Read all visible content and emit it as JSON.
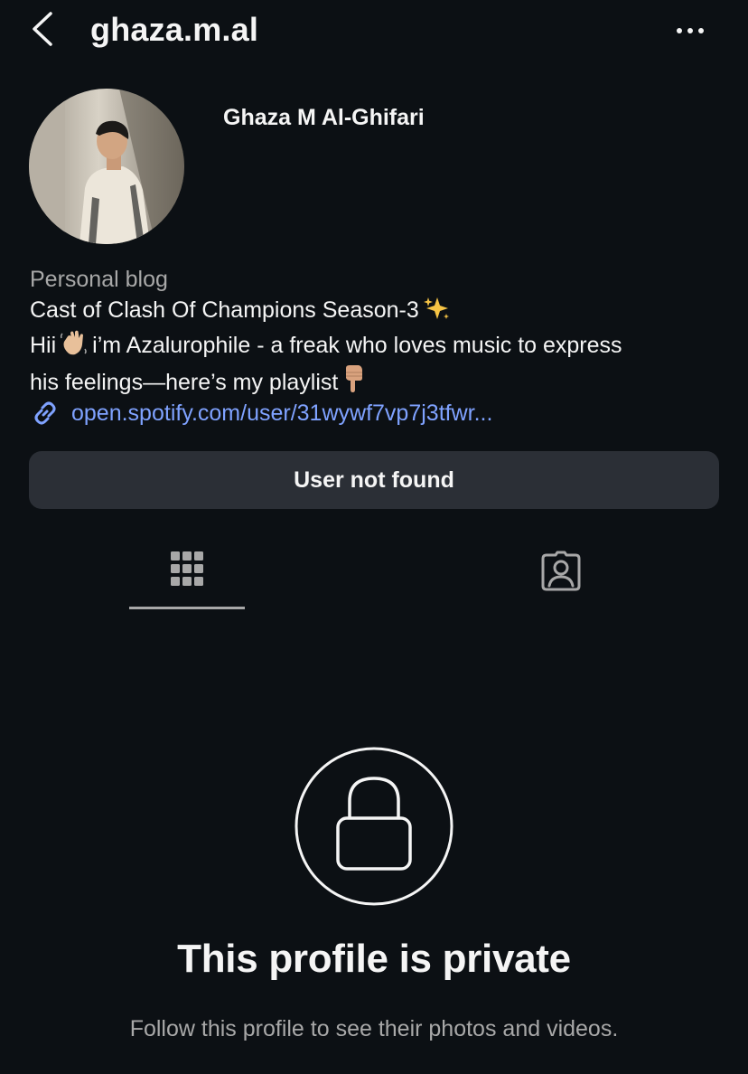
{
  "header": {
    "username": "ghaza.m.al",
    "back_icon": "chevron-left-icon",
    "more_icon": "more-horizontal-icon"
  },
  "profile": {
    "full_name": "Ghaza M Al-Ghifari",
    "avatar": "profile-photo",
    "category": "Personal blog",
    "bio_line_1": "Cast of Clash Of Champions Season-3",
    "bio_line_1_emoji": "sparkles",
    "bio_line_2_pre": "Hii",
    "bio_line_2_emoji": "waving-hand",
    "bio_line_2_post": "i’m Azalurophile - a freak who loves music to express",
    "bio_line_3": "his feelings—here’s my playlist",
    "bio_line_3_emoji": "pointing-down-hand",
    "link_text": "open.spotify.com/user/31wywf7vp7j3tfwr...",
    "link_icon": "link-icon"
  },
  "status_button": {
    "label": "User not found"
  },
  "tabs": [
    {
      "icon": "grid-icon",
      "selected": true
    },
    {
      "icon": "tagged-user-icon",
      "selected": false
    }
  ],
  "private_notice": {
    "icon": "lock-icon",
    "title": "This profile is private",
    "subtitle": "Follow this profile to see their photos and videos."
  },
  "colors": {
    "background": "#0c1014",
    "text": "#f5f5f5",
    "secondary_text": "#a8a8a8",
    "link": "#7fa2ff",
    "button_bg": "#2b2f36"
  }
}
